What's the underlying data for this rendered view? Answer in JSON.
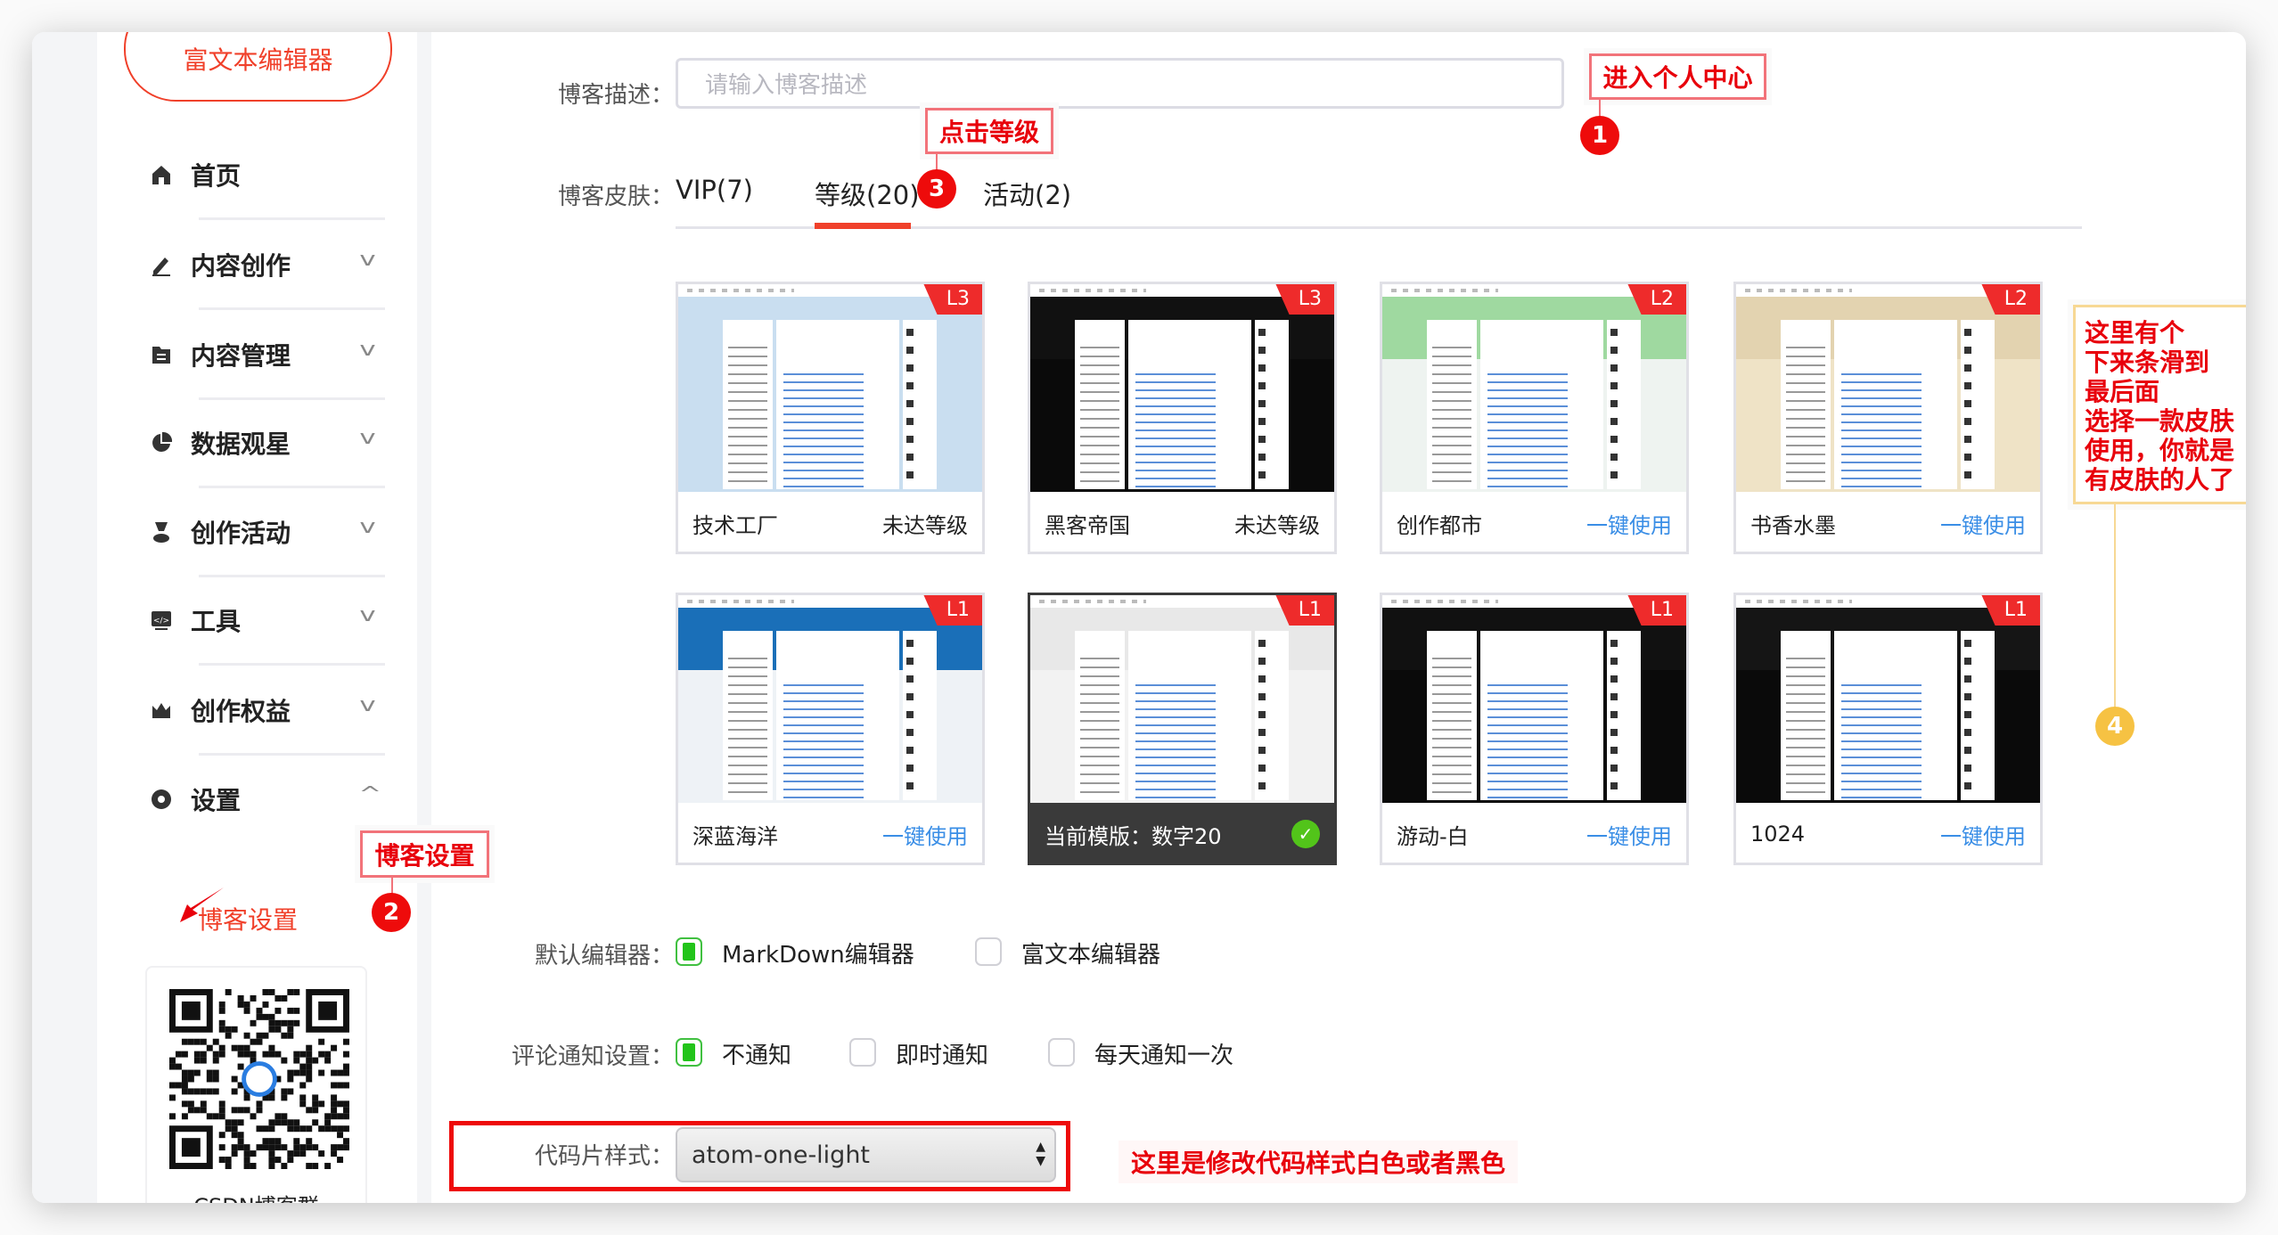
{
  "sidebar": {
    "rich_editor_button": "富文本编辑器",
    "items": [
      {
        "label": "首页",
        "icon": "home-icon",
        "chevron": ""
      },
      {
        "label": "内容创作",
        "icon": "pen-icon",
        "chevron": "v"
      },
      {
        "label": "内容管理",
        "icon": "folder-icon",
        "chevron": "v"
      },
      {
        "label": "数据观星",
        "icon": "pie-chart-icon",
        "chevron": "v"
      },
      {
        "label": "创作活动",
        "icon": "trophy-icon",
        "chevron": "v"
      },
      {
        "label": "工具",
        "icon": "code-icon",
        "chevron": "v"
      },
      {
        "label": "创作权益",
        "icon": "crown-icon",
        "chevron": "v"
      },
      {
        "label": "设置",
        "icon": "gear-icon",
        "chevron": "^"
      }
    ],
    "sub_item": "博客设置",
    "qr_caption": "CSDN博客群"
  },
  "form": {
    "desc_label": "博客描述：",
    "desc_placeholder": "请输入博客描述",
    "skin_label": "博客皮肤：",
    "tabs": [
      "VIP(7)",
      "等级(20)",
      "活动(2)"
    ],
    "active_tab": 1,
    "editor_label": "默认编辑器：",
    "editor_options": [
      {
        "label": "MarkDown编辑器",
        "checked": true
      },
      {
        "label": "富文本编辑器",
        "checked": false
      }
    ],
    "comment_label": "评论通知设置：",
    "comment_options": [
      {
        "label": "不通知",
        "checked": true
      },
      {
        "label": "即时通知",
        "checked": false
      },
      {
        "label": "每天通知一次",
        "checked": false
      }
    ],
    "code_label": "代码片样式：",
    "code_value": "atom-one-light"
  },
  "skins": [
    {
      "name": "技术工厂",
      "status": "未达等级",
      "type": "locked",
      "level": "L3",
      "bg": "#c9def0",
      "banner": "#c9def0"
    },
    {
      "name": "黑客帝国",
      "status": "未达等级",
      "type": "locked",
      "level": "L3",
      "bg": "#0a0a0a",
      "banner": "#111111"
    },
    {
      "name": "创作都市",
      "status": "一键使用",
      "type": "use",
      "level": "L2",
      "bg": "#eef3f0",
      "banner": "#9fd9a0"
    },
    {
      "name": "书香水墨",
      "status": "一键使用",
      "type": "use",
      "level": "L2",
      "bg": "#efe3c6",
      "banner": "#e3d3b0"
    },
    {
      "name": "深蓝海洋",
      "status": "一键使用",
      "type": "use",
      "level": "L1",
      "bg": "#eef2f6",
      "banner": "#1a6fb8"
    },
    {
      "name": "当前模版：数字20",
      "status": "",
      "type": "current",
      "level": "L1",
      "bg": "#f2f2f2",
      "banner": "#e8e8e8"
    },
    {
      "name": "游动-白",
      "status": "一键使用",
      "type": "use",
      "level": "L1",
      "bg": "#0a0a0a",
      "banner": "#111111"
    },
    {
      "name": "1024",
      "status": "一键使用",
      "type": "use",
      "level": "L1",
      "bg": "#0a0a0a",
      "banner": "#151515"
    }
  ],
  "annotations": {
    "a1": {
      "text": "进入个人中心",
      "num": "1"
    },
    "a2": {
      "text": "博客设置",
      "num": "2"
    },
    "a3": {
      "text": "点击等级",
      "num": "3"
    },
    "a4": {
      "text": "这里有个\n下来条滑到\n最后面\n选择一款皮肤\n使用，你就是\n有皮肤的人了",
      "num": "4"
    },
    "code_note": "这里是修改代码样式白色或者黑色"
  },
  "colors": {
    "brand": "#f0402a",
    "annotation": "#e8000b",
    "link": "#3a8ee6",
    "check": "#52c41a"
  }
}
